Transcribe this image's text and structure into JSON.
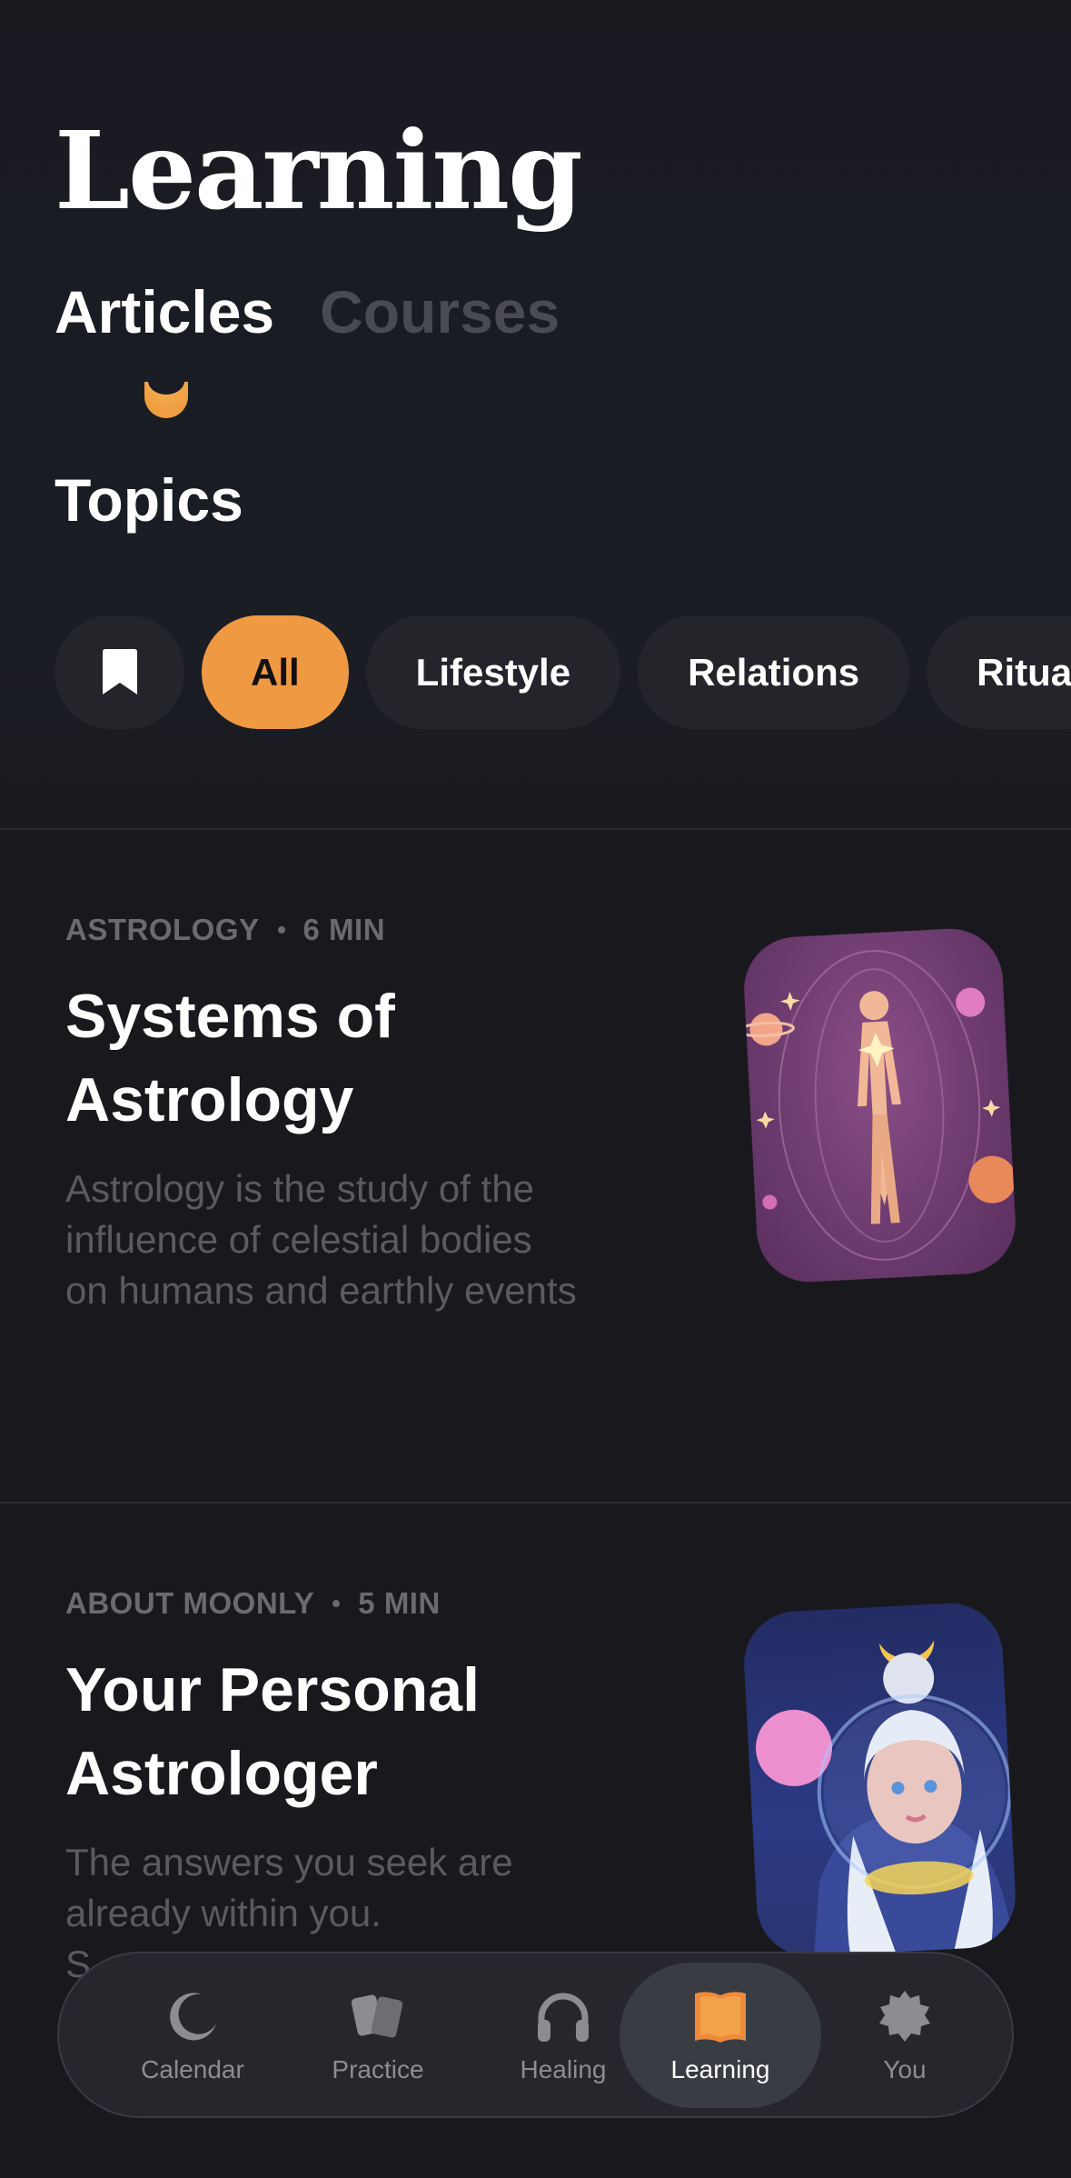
{
  "header": {
    "title": "Learning",
    "tabs": [
      {
        "label": "Articles",
        "active": true
      },
      {
        "label": "Courses",
        "active": false
      }
    ]
  },
  "topics": {
    "title": "Topics",
    "chips": [
      {
        "icon": "bookmark-icon"
      },
      {
        "label": "All",
        "active": true
      },
      {
        "label": "Lifestyle"
      },
      {
        "label": "Relations"
      },
      {
        "label": "Ritua"
      }
    ]
  },
  "articles": [
    {
      "category": "ASTROLOGY",
      "duration": "6 MIN",
      "title_line1": "Systems of",
      "title_line2": "Astrology",
      "desc_line1": "Astrology is the study of the",
      "desc_line2": "influence of celestial bodies",
      "desc_line3": "on humans and earthly events",
      "image_icon": "astrology-human-figure-icon"
    },
    {
      "category": "ABOUT MOONLY",
      "duration": "5 MIN",
      "title_line1": "Your Personal",
      "title_line2": "Astrologer",
      "desc_line1": "The answers you seek are",
      "desc_line2": "already within you.",
      "desc_line3": "S",
      "image_icon": "astrologer-avatar-icon"
    }
  ],
  "bottom_nav": {
    "items": [
      {
        "label": "Calendar",
        "icon": "moon-icon"
      },
      {
        "label": "Practice",
        "icon": "cards-icon"
      },
      {
        "label": "Healing",
        "icon": "headphones-icon"
      },
      {
        "label": "Learning",
        "icon": "book-icon",
        "active": true
      },
      {
        "label": "You",
        "icon": "badge-icon"
      }
    ]
  },
  "colors": {
    "background": "#19191d",
    "accent": "#ef9a43",
    "chip_bg": "#24252a",
    "muted_text": "#6a6b70"
  }
}
